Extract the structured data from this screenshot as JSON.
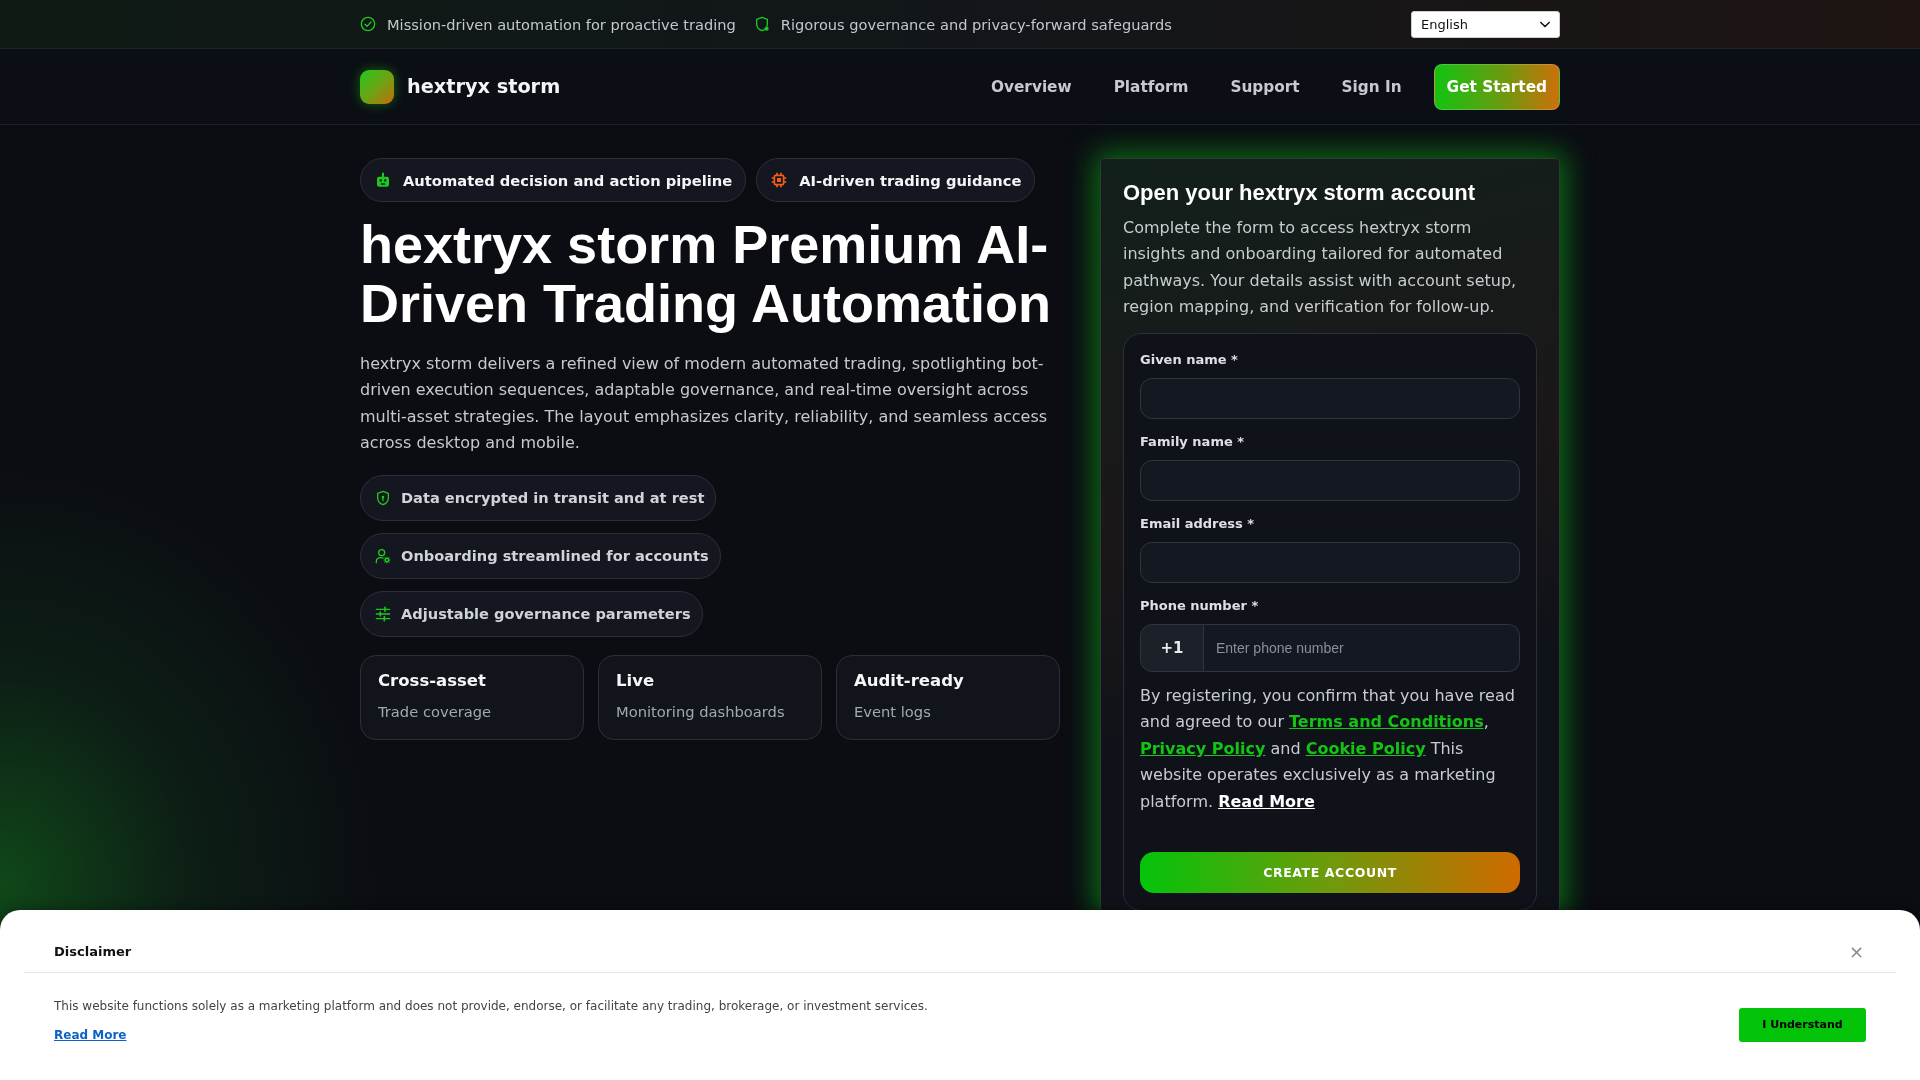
{
  "top_bar": {
    "highlights": [
      "Mission-driven automation for proactive trading",
      "Rigorous governance and privacy-forward safeguards"
    ],
    "language": {
      "value": "English"
    }
  },
  "header": {
    "brand": "hextryx storm",
    "nav": [
      "Overview",
      "Platform",
      "Support",
      "Sign In"
    ],
    "cta": "Get Started"
  },
  "hero": {
    "badges": [
      {
        "label": "Automated decision and action pipeline",
        "color": "#1ec81e"
      },
      {
        "label": "AI-driven trading guidance",
        "color": "#f25c14"
      }
    ],
    "title": "hextryx storm Premium AI-Driven Trading Automation",
    "description": "hextryx storm delivers a refined view of modern automated trading, spotlighting bot-driven execution sequences, adaptable governance, and real-time oversight across multi-asset strategies. The layout emphasizes clarity, reliability, and seamless access across desktop and mobile.",
    "features": [
      "Data encrypted in transit and at rest",
      "Onboarding streamlined for accounts",
      "Adjustable governance parameters"
    ],
    "stats": [
      {
        "title": "Cross-asset",
        "subtitle": "Trade coverage"
      },
      {
        "title": "Live",
        "subtitle": "Monitoring dashboards"
      },
      {
        "title": "Audit-ready",
        "subtitle": "Event logs"
      }
    ]
  },
  "signup": {
    "title": "Open your hextryx storm account",
    "description": "Complete the form to access hextryx storm insights and onboarding tailored for automated pathways. Your details assist with account setup, region mapping, and verification for follow-up.",
    "fields": [
      {
        "kind": "text",
        "label": "Given name *"
      },
      {
        "kind": "text",
        "label": "Family name *"
      },
      {
        "kind": "text",
        "label": "Email address *"
      },
      {
        "kind": "phone",
        "label": "Phone number *",
        "prefix": "+1",
        "placeholder": "Enter phone number"
      }
    ],
    "consent": [
      {
        "kind": "plain",
        "text": "By registering, you confirm that you have read and agreed to our "
      },
      {
        "kind": "link",
        "text": "Terms and Conditions"
      },
      {
        "kind": "plain",
        "text": ", "
      },
      {
        "kind": "link",
        "text": "Privacy Policy"
      },
      {
        "kind": "plain",
        "text": " and "
      },
      {
        "kind": "link",
        "text": "Cookie Policy"
      },
      {
        "kind": "plain",
        "text": " This website operates exclusively as a marketing platform. "
      },
      {
        "kind": "more",
        "text": "Read More"
      }
    ],
    "submit": "CREATE ACCOUNT"
  },
  "disclaimer": {
    "title": "Disclaimer",
    "close": "×",
    "text": "This website functions solely as a marketing platform and does not provide, endorse, or facilitate any trading, brokerage, or investment services.",
    "link": "Read More",
    "button": "I Understand"
  }
}
